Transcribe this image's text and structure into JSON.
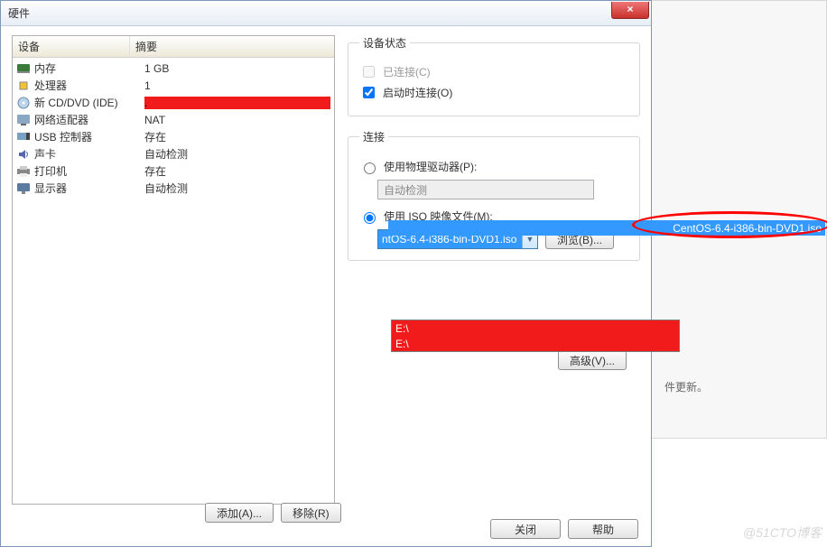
{
  "dialog": {
    "title": "硬件",
    "close_glyph": "×"
  },
  "table": {
    "header_device": "设备",
    "header_summary": "摘要",
    "rows": [
      {
        "icon": "memory-icon",
        "device": "内存",
        "summary": "1 GB"
      },
      {
        "icon": "cpu-icon",
        "device": "处理器",
        "summary": "1"
      },
      {
        "icon": "disc-icon",
        "device": "新 CD/DVD (IDE)",
        "summary": ""
      },
      {
        "icon": "nic-icon",
        "device": "网络适配器",
        "summary": "NAT"
      },
      {
        "icon": "usb-icon",
        "device": "USB 控制器",
        "summary": "存在"
      },
      {
        "icon": "sound-icon",
        "device": "声卡",
        "summary": "自动检测"
      },
      {
        "icon": "printer-icon",
        "device": "打印机",
        "summary": "存在"
      },
      {
        "icon": "monitor-icon",
        "device": "显示器",
        "summary": "自动检测"
      }
    ]
  },
  "status": {
    "legend": "设备状态",
    "connected_label": "已连接(C)",
    "connect_on_start_label": "启动时连接(O)",
    "connect_on_start_checked": true
  },
  "connection": {
    "legend": "连接",
    "use_physical_label": "使用物理驱动器(P):",
    "physical_value": "自动检测",
    "use_iso_label": "使用 ISO 映像文件(M):",
    "selected_iso": "ntOS-6.4-i386-bin-DVD1.iso",
    "browse_label": "浏览(B)...",
    "advanced_label": "高级(V)...",
    "dropdown_options": [
      "E:\\",
      "E:\\"
    ]
  },
  "overflow_item": "CentOS-6.4-i386-bin-DVD1.iso",
  "buttons": {
    "add": "添加(A)...",
    "remove": "移除(R)",
    "close": "关闭",
    "help": "帮助"
  },
  "bg_text": "件更新。",
  "watermark": "@51CTO博客"
}
